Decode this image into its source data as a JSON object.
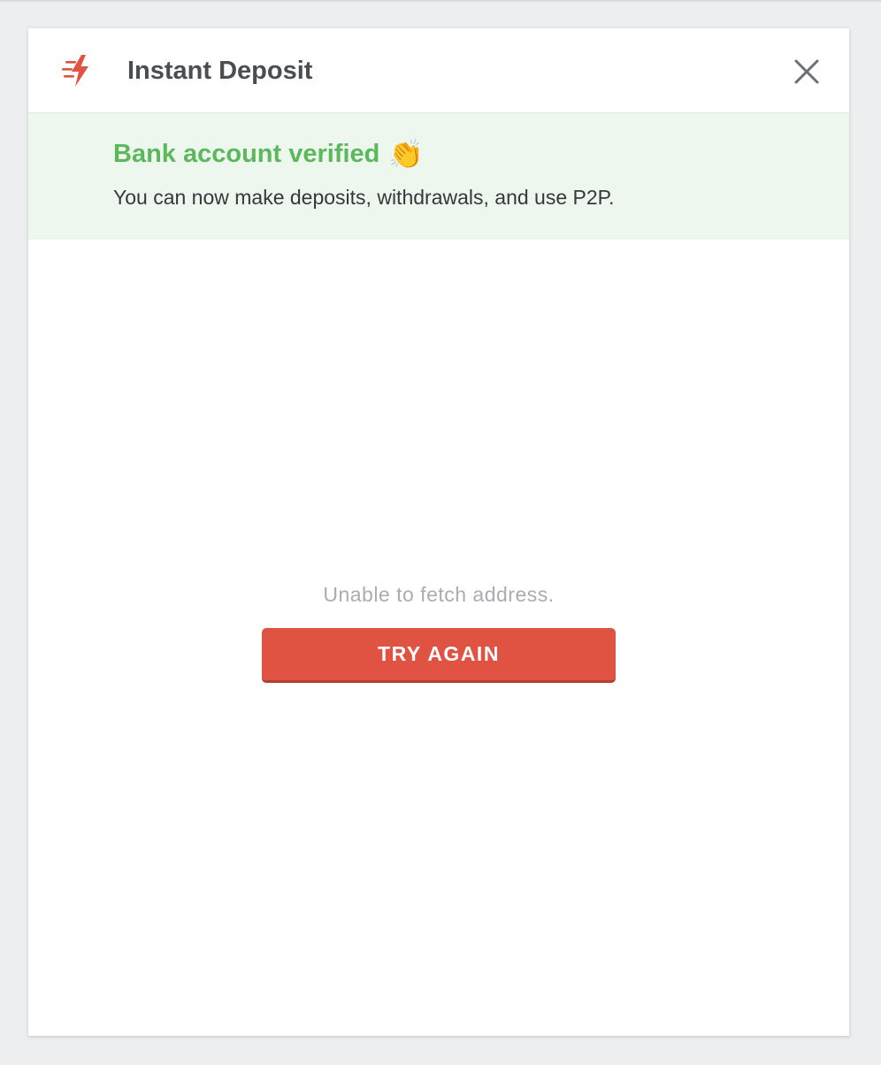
{
  "modal": {
    "title": "Instant Deposit",
    "icons": {
      "logo": "instant-bolt-icon",
      "close": "close-icon"
    }
  },
  "banner": {
    "title": "Bank account verified",
    "emoji": "👏",
    "message": "You can now make deposits, withdrawals, and use P2P."
  },
  "error": {
    "message": "Unable to fetch address.",
    "retry_label": "TRY AGAIN"
  },
  "colors": {
    "accent": "#e05342",
    "success": "#5cb85c",
    "banner_bg": "#eef7ee",
    "page_bg": "#edeef0"
  }
}
